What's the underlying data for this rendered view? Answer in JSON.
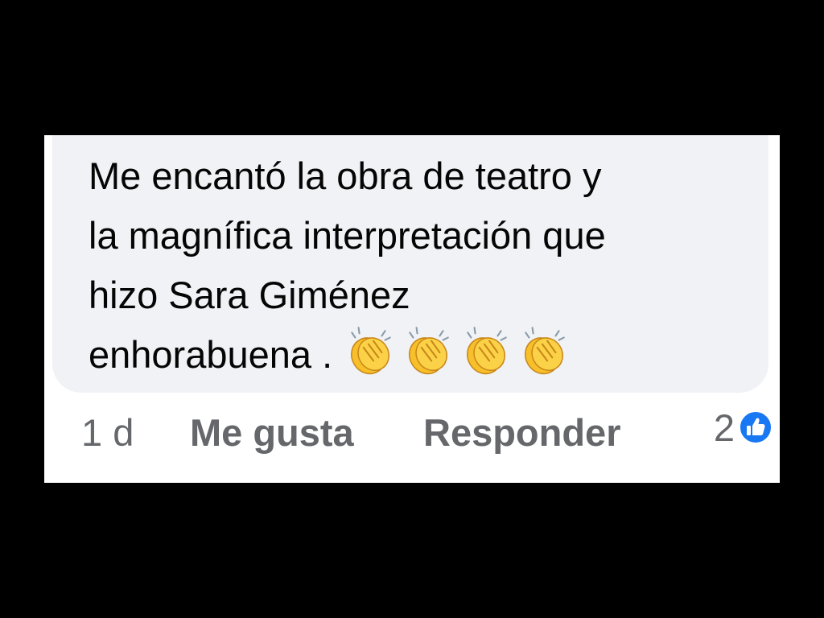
{
  "comment": {
    "lines": [
      "Me encantó la obra de teatro y",
      "la magnífica interpretación que",
      "hizo Sara Giménez",
      "enhorabuena ."
    ],
    "emojis": [
      "clap-icon",
      "clap-icon",
      "clap-icon",
      "clap-icon"
    ]
  },
  "actions": {
    "timestamp": "1 d",
    "like_label": "Me gusta",
    "reply_label": "Responder",
    "reaction_count": "2",
    "reaction_icon": "thumbs-up-icon"
  },
  "colors": {
    "background": "#000000",
    "card": "#ffffff",
    "bubble": "#f0f2f5",
    "text": "#050505",
    "secondary_text": "#65676b",
    "like_blue": "#1877f2",
    "emoji_yellow": "#f7c02b"
  }
}
